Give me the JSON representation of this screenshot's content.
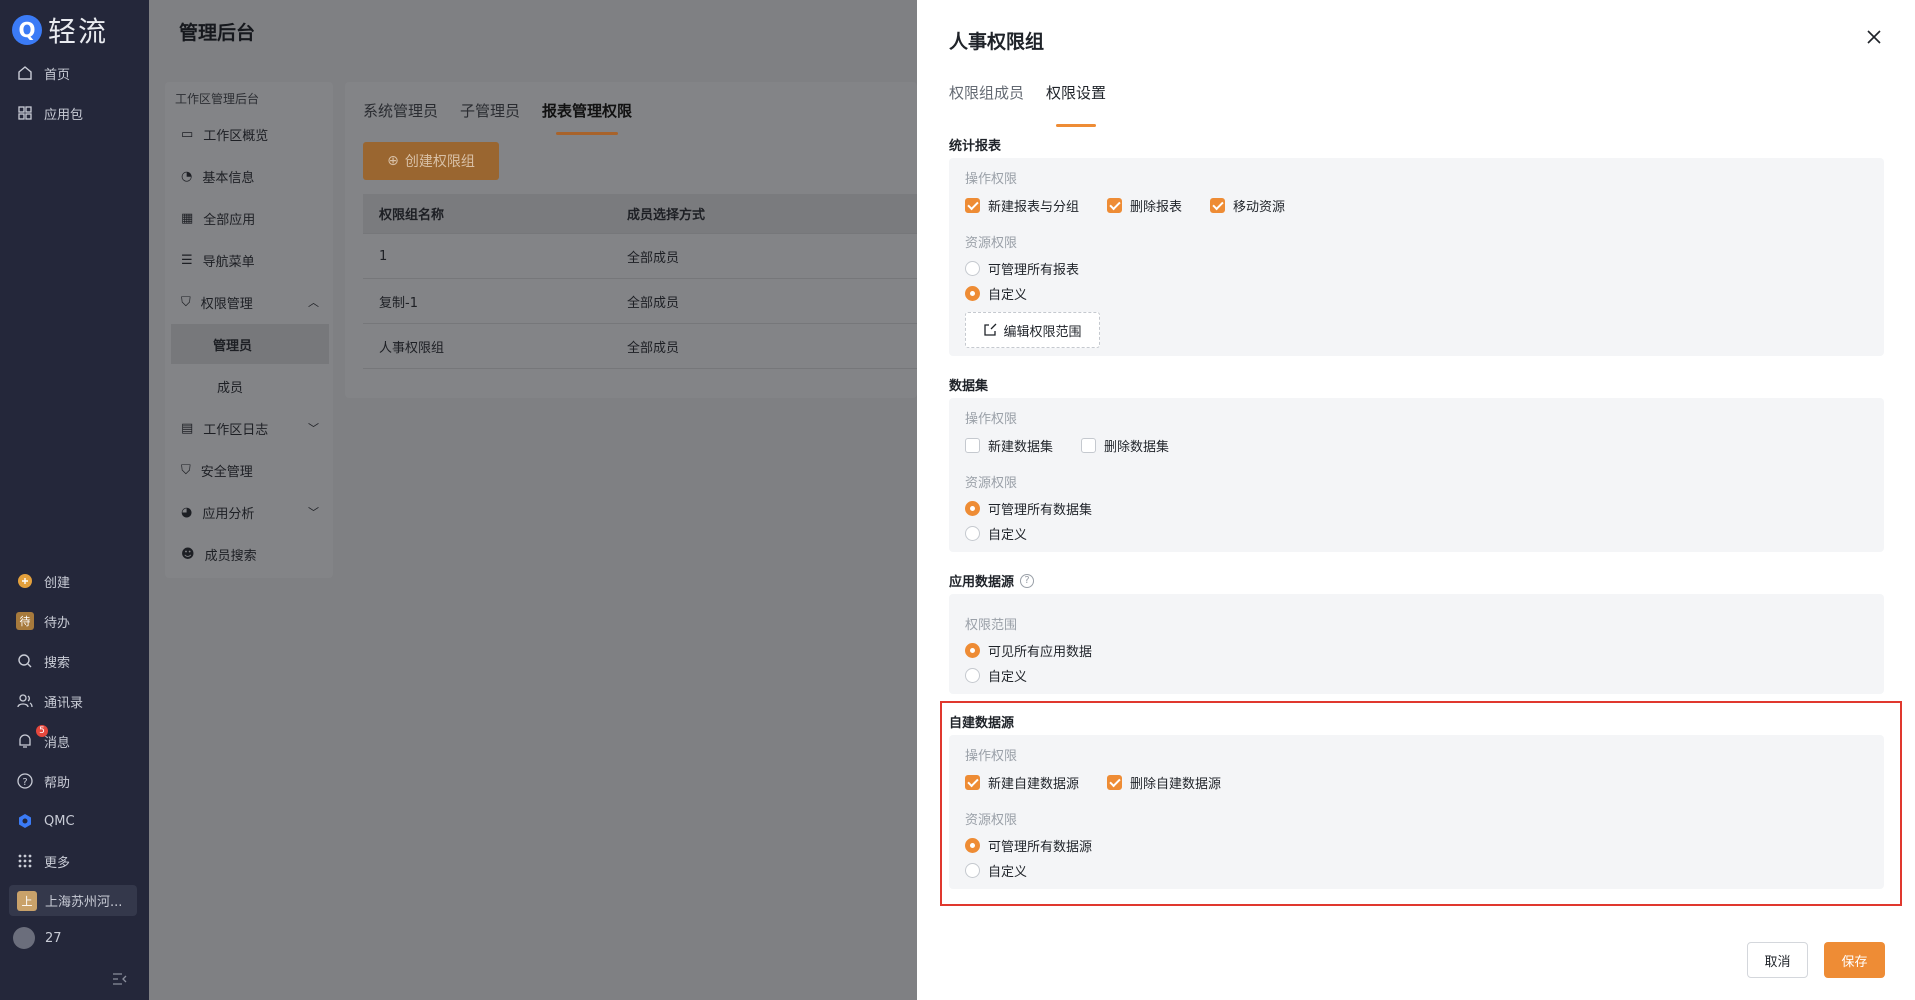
{
  "app": {
    "logo_letter": "Q",
    "logo_text": "轻流"
  },
  "sidebar": {
    "top_items": [
      {
        "label": "首页",
        "icon": "home-icon"
      },
      {
        "label": "应用包",
        "icon": "grid-icon"
      }
    ],
    "bottom_items": [
      {
        "label": "创建",
        "icon": "plus-circle-icon"
      },
      {
        "label": "待办",
        "icon": "todo-icon",
        "icon_text": "待"
      },
      {
        "label": "搜索",
        "icon": "search-icon"
      },
      {
        "label": "通讯录",
        "icon": "contacts-icon"
      },
      {
        "label": "消息",
        "icon": "bell-icon",
        "badge": "5"
      },
      {
        "label": "帮助",
        "icon": "help-icon"
      },
      {
        "label": "QMC",
        "icon": "qmc-icon"
      },
      {
        "label": "更多",
        "icon": "more-icon"
      }
    ],
    "company": {
      "icon_text": "上",
      "label": "上海苏州河..."
    },
    "user_label": "27"
  },
  "main": {
    "title": "管理后台",
    "workspace_nav": {
      "header": "工作区管理后台",
      "items": [
        {
          "label": "工作区概览"
        },
        {
          "label": "基本信息"
        },
        {
          "label": "全部应用"
        },
        {
          "label": "导航菜单"
        },
        {
          "label": "权限管理"
        },
        {
          "label": "管理员"
        },
        {
          "label": "成员"
        },
        {
          "label": "工作区日志"
        },
        {
          "label": "安全管理"
        },
        {
          "label": "应用分析"
        },
        {
          "label": "成员搜索"
        }
      ]
    },
    "tabs": [
      "系统管理员",
      "子管理员",
      "报表管理权限"
    ],
    "create_button": "创建权限组",
    "table": {
      "headers": [
        "权限组名称",
        "成员选择方式"
      ],
      "rows": [
        [
          "1",
          "全部成员"
        ],
        [
          "复制-1",
          "全部成员"
        ],
        [
          "人事权限组",
          "全部成员"
        ]
      ]
    }
  },
  "drawer": {
    "title": "人事权限组",
    "tabs": [
      "权限组成员",
      "权限设置"
    ],
    "sections": {
      "report": {
        "title": "统计报表",
        "op_label": "操作权限",
        "ops": [
          "新建报表与分组",
          "删除报表",
          "移动资源"
        ],
        "res_label": "资源权限",
        "res": [
          "可管理所有报表",
          "自定义"
        ],
        "edit_button": "编辑权限范围"
      },
      "dataset": {
        "title": "数据集",
        "op_label": "操作权限",
        "ops": [
          "新建数据集",
          "删除数据集"
        ],
        "res_label": "资源权限",
        "res": [
          "可管理所有数据集",
          "自定义"
        ]
      },
      "app_source": {
        "title": "应用数据源",
        "scope_label": "权限范围",
        "res": [
          "可见所有应用数据",
          "自定义"
        ]
      },
      "custom_source": {
        "title": "自建数据源",
        "op_label": "操作权限",
        "ops": [
          "新建自建数据源",
          "删除自建数据源"
        ],
        "res_label": "资源权限",
        "res": [
          "可管理所有数据源",
          "自定义"
        ]
      }
    },
    "cancel": "取消",
    "save": "保存"
  },
  "colors": {
    "accent": "#ee8c35",
    "sidebar_bg": "#24273a",
    "highlight": "#e0382e"
  }
}
